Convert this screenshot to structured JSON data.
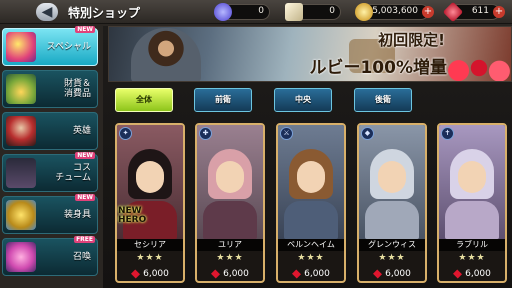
{
  "header": {
    "back_label": "◀",
    "title": "特別ショップ"
  },
  "currencies": [
    {
      "name": "crystal-icon",
      "value": "0",
      "color": "#6a6cf2"
    },
    {
      "name": "ticket-icon",
      "value": "0",
      "color": "#e9dfb8"
    },
    {
      "name": "gold-coin-icon",
      "value": "5,003,600",
      "color": "#e8b62a"
    },
    {
      "name": "ruby-icon",
      "value": "611",
      "color": "#e0162e"
    }
  ],
  "sidebar": {
    "items": [
      {
        "label": "スペシャル",
        "new": true,
        "new_label": "NEW",
        "active": true,
        "icon": "special-bundle-icon"
      },
      {
        "label": "財貨＆\n消費品",
        "new": false,
        "active": false,
        "icon": "currency-items-icon"
      },
      {
        "label": "英雄",
        "new": false,
        "active": false,
        "icon": "hero-icon"
      },
      {
        "label": "コス\nチューム",
        "new": true,
        "new_label": "NEW",
        "active": false,
        "icon": "costume-icon"
      },
      {
        "label": "装身具",
        "new": true,
        "new_label": "NEW",
        "active": false,
        "icon": "accessory-icon"
      },
      {
        "label": "召喚",
        "new": true,
        "new_label": "FREE",
        "active": false,
        "icon": "summon-icon"
      }
    ]
  },
  "banner": {
    "line1": "初回限定!",
    "line2": "ルビー100%増量"
  },
  "filters": [
    {
      "label": "全体",
      "active": true
    },
    {
      "label": "前衛",
      "active": false
    },
    {
      "label": "中央",
      "active": false
    },
    {
      "label": "後衛",
      "active": false
    }
  ],
  "heroes": [
    {
      "name": "セシリア",
      "stars": "★★★",
      "price": "6,000",
      "new_label": "NEW\nHERO",
      "role_icon": "mage-role-icon",
      "hair": "#1e1516",
      "body": "#7a1e28",
      "bg": "#6b4a52"
    },
    {
      "name": "ユリア",
      "stars": "★★★",
      "price": "6,000",
      "new_label": "",
      "role_icon": "healer-role-icon",
      "hair": "#d9a0a8",
      "body": "#5e3a4a",
      "bg": "#7a6470"
    },
    {
      "name": "ベルンヘイム",
      "stars": "★★★",
      "price": "6,000",
      "new_label": "",
      "role_icon": "warrior-role-icon",
      "hair": "#8a5a32",
      "body": "#4e5e78",
      "bg": "#5c6a80"
    },
    {
      "name": "グレンウィス",
      "stars": "★★★",
      "price": "6,000",
      "new_label": "",
      "role_icon": "shield-role-icon",
      "hair": "#cfd6e0",
      "body": "#a0a8b8",
      "bg": "#6e7a8a"
    },
    {
      "name": "ラブリル",
      "stars": "★★★",
      "price": "6,000",
      "new_label": "",
      "role_icon": "cross-role-icon",
      "hair": "#d9d2e8",
      "body": "#b8a8c8",
      "bg": "#8a7ca0"
    }
  ]
}
